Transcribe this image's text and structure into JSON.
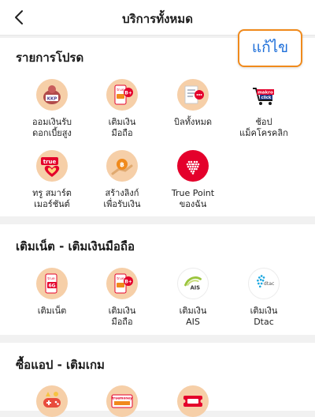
{
  "header": {
    "title": "บริการทั้งหมด"
  },
  "edit_button": {
    "label": "แก้ไข"
  },
  "sections": [
    {
      "title": "รายการโปรด",
      "items": [
        {
          "label": "ออมเงินรับ\nดอกเบี้ยสูง",
          "icon": "kkp-piggy-icon"
        },
        {
          "label": "เติมเงิน\nมือถือ",
          "icon": "phone-topup-icon"
        },
        {
          "label": "บิลทั้งหมด",
          "icon": "bill-icon"
        },
        {
          "label": "ช้อป\nแม็คโครคลิก",
          "icon": "makro-click-icon"
        },
        {
          "label": "ทรู สมาร์ต\nเมอร์ชันต์",
          "icon": "true-smart-merchant-icon"
        },
        {
          "label": "สร้างลิงก์\nเพื่อรับเงิน",
          "icon": "payment-link-icon"
        },
        {
          "label": "True Point\nของฉัน",
          "icon": "true-point-icon"
        }
      ]
    },
    {
      "title": "เติมเน็ต - เติมเงินมือถือ",
      "items": [
        {
          "label": "เติมเน็ต",
          "icon": "data-topup-icon"
        },
        {
          "label": "เติมเงิน\nมือถือ",
          "icon": "phone-topup-icon"
        },
        {
          "label": "เติมเงิน\nAIS",
          "icon": "ais-icon"
        },
        {
          "label": "เติมเงิน\nDtac",
          "icon": "dtac-icon"
        }
      ]
    },
    {
      "title": "ซื้อแอป - เติมเกม",
      "items": [
        {
          "label": "",
          "icon": "game-icon"
        },
        {
          "label": "",
          "icon": "truemoney-card-icon"
        },
        {
          "label": "",
          "icon": "ticket-icon"
        }
      ]
    }
  ],
  "icon_text": {
    "kkp": "KKP",
    "true_small": "true",
    "bplus": "B+",
    "makro": "makro",
    "click": "click",
    "true_brand": "true",
    "sixg": "6G",
    "ais": "AIS",
    "dtac": "dtac",
    "truemoney": "truemoney"
  },
  "colors": {
    "accent_orange": "#f08a1c",
    "edit_blue": "#1e6fd9",
    "true_red": "#e4002b",
    "peach": "#f6cfa8"
  }
}
